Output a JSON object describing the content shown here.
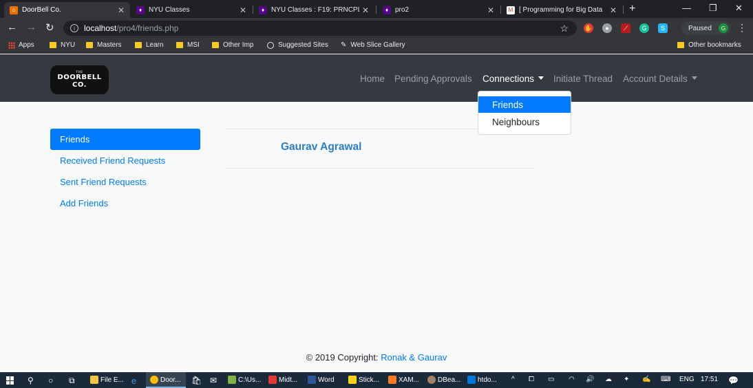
{
  "browser": {
    "tabs": [
      {
        "title": "DoorBell Co.",
        "favicon": "doorbell-favicon"
      },
      {
        "title": "NYU Classes",
        "favicon": "nyu-torch-favicon"
      },
      {
        "title": "NYU Classes : F19: PRNCPL",
        "favicon": "nyu-torch-favicon"
      },
      {
        "title": "pro2",
        "favicon": "nyu-torch-favicon"
      },
      {
        "title": "[ Programming for Big Data",
        "favicon": "gmail-favicon"
      }
    ],
    "url_host": "localhost",
    "url_path": "/pro4/friends.php",
    "profile_status": "Paused",
    "profile_initial": "G",
    "bookmarks": [
      "Apps",
      "NYU",
      "Masters",
      "Learn",
      "MSI",
      "Other Imp",
      "Suggested Sites",
      "Web Slice Gallery"
    ],
    "other_bookmarks": "Other bookmarks"
  },
  "navbar": {
    "logo_line1": "DOORBELL",
    "logo_line2": "CO.",
    "logo_tiny": "THE",
    "links": [
      "Home",
      "Pending Approvals",
      "Connections",
      "Initiate Thread",
      "Account Details"
    ],
    "dropdown_items": [
      "Friends",
      "Neighbours"
    ]
  },
  "sidebar": {
    "items": [
      "Friends",
      "Received Friend Requests",
      "Sent Friend Requests",
      "Add Friends"
    ]
  },
  "main": {
    "friends": [
      "Gaurav Agrawal"
    ]
  },
  "footer": {
    "text": "© 2019 Copyright: ",
    "link": "Ronak & Gaurav"
  },
  "taskbar": {
    "apps": [
      "File E...",
      "Door...",
      "C:\\Us...",
      "Midt...",
      "Word",
      "Stick...",
      "XAM...",
      "DBea...",
      "htdo..."
    ],
    "language": "ENG",
    "time": "17:51"
  },
  "colors": {
    "primary": "#007bff",
    "navbar_bg": "#343a40",
    "page_bg": "#f8f9fa",
    "friend_name": "#2a7dc8"
  }
}
